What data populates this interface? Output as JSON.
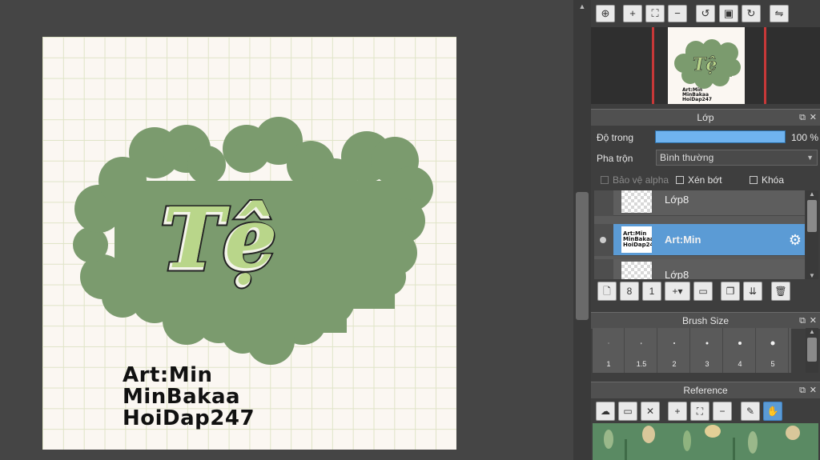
{
  "canvas": {
    "title_text": "Tệ",
    "credits": [
      "Art:Min",
      "MinBakaa",
      "HoiDap247"
    ],
    "colors": {
      "cloud": "#7b9b6e",
      "letters": "#b9d68a",
      "paper": "#fbf7f2",
      "grid": "#dfe4c7"
    }
  },
  "navigator": {
    "toolbar_icons": [
      "zoom-fit-icon",
      "zoom-in-icon",
      "fit-window-icon",
      "zoom-out-icon",
      "rotate-left-icon",
      "actual-size-icon",
      "rotate-right-icon",
      "flip-icon"
    ],
    "preview_title": "Tệ",
    "preview_credits": [
      "Art:Min",
      "MinBakaa",
      "HoiDap247"
    ]
  },
  "layer_panel": {
    "title": "Lớp",
    "opacity_label": "Độ trong",
    "opacity_value": "100 %",
    "opacity_fraction": 1.0,
    "blend_label": "Pha trộn",
    "blend_value": "Bình thường",
    "protect_alpha": "Bảo vệ alpha",
    "clipping": "Xén bớt",
    "lock": "Khóa",
    "layers": [
      {
        "name": "Lớp8",
        "selected": false
      },
      {
        "name": "Art:Min",
        "selected": true
      },
      {
        "name": "Lớp8",
        "selected": false
      }
    ],
    "selected_thumb_text": [
      "Art:Min",
      "MinBakaa",
      "HoiDap247"
    ]
  },
  "brush_panel": {
    "title": "Brush Size",
    "sizes": [
      "1",
      "1.5",
      "2",
      "3",
      "4",
      "5"
    ]
  },
  "reference_panel": {
    "title": "Reference"
  }
}
